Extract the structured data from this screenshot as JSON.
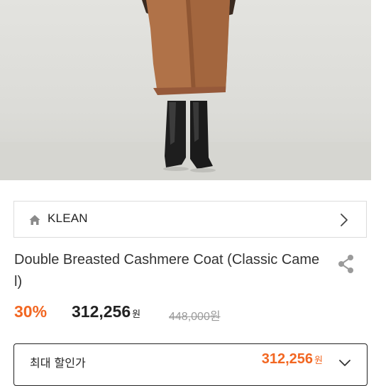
{
  "brand": {
    "icon": "home-icon",
    "name": "KLEAN",
    "chevron_icon": "chevron-right-icon"
  },
  "product": {
    "title": "Double Breasted Cashmere Coat (Classic Camel)",
    "share_icon": "share-icon"
  },
  "pricing": {
    "discount": "30%",
    "sale_price": "312,256",
    "currency": "원",
    "original_price": "448,000원",
    "accent_color": "#f26722"
  },
  "max_discount": {
    "label": "최대 할인가",
    "price": "312,256",
    "currency": "원",
    "chevron_icon": "chevron-down-icon"
  }
}
